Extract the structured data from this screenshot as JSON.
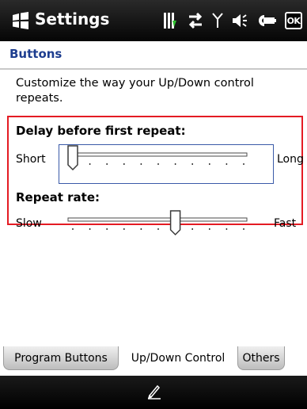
{
  "titlebar": {
    "title": "Settings",
    "ok_label": "OK",
    "icons": [
      "windows-start-icon",
      "battery-charging-icon",
      "connectivity-icon",
      "signal-icon",
      "speaker-icon",
      "keyboard-icon"
    ]
  },
  "header": {
    "title": "Buttons"
  },
  "description": "Customize the way your Up/Down control repeats.",
  "delay": {
    "label": "Delay before first repeat:",
    "min_label": "Short",
    "max_label": "Long",
    "value": 0,
    "ticks": 11
  },
  "rate": {
    "label": "Repeat rate:",
    "min_label": "Slow",
    "max_label": "Fast",
    "value": 0.6,
    "ticks": 11
  },
  "tabs": [
    {
      "label": "Program Buttons",
      "active": false
    },
    {
      "label": "Up/Down Control",
      "active": true
    },
    {
      "label": "Others",
      "active": false
    }
  ],
  "colors": {
    "highlight": "#e41b23",
    "header_text": "#1d3d8f",
    "focus_border": "#3a5aa8"
  },
  "bottombar": {
    "icon": "pen-input-icon"
  }
}
